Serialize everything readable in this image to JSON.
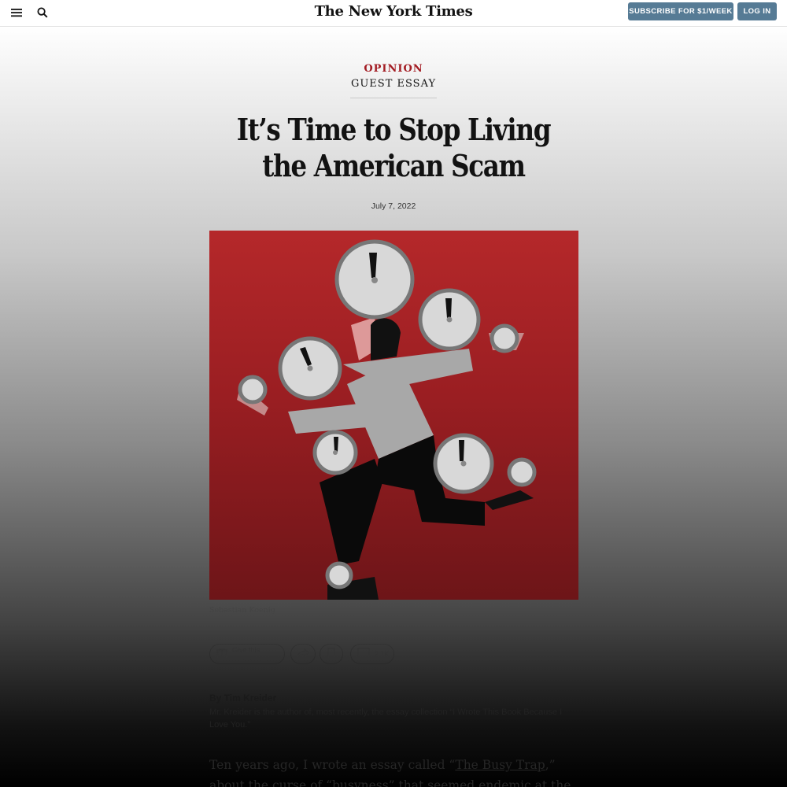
{
  "header": {
    "logo": "The New York Times",
    "subscribe_label": "SUBSCRIBE FOR $1/WEEK",
    "login_label": "LOG IN",
    "menu_icon": "menu-icon",
    "search_icon": "search-icon"
  },
  "article": {
    "section": "OPINION",
    "kicker": "GUEST ESSAY",
    "headline": "It’s Time to Stop Living the American Scam",
    "date": "July 7, 2022",
    "image_credit": "Sebastian Koenig",
    "byline": "By Tim Kreider",
    "author_bio": "Mr. Kreider is the author of, most recently, the essay collection “I Wrote This Book Because I Love You.”",
    "body_intro": "Ten years ago, I wrote an essay called “",
    "body_link": "The Busy Trap",
    "body_rest": ",” about the curse of “busyness” that seemed endemic at the time. The"
  },
  "tools": {
    "gift_label": "Give this article",
    "comment_count": "2.1K"
  },
  "colors": {
    "accent": "#a31c23",
    "button": "#567b95",
    "illustration_bg": "#9a1e22"
  }
}
